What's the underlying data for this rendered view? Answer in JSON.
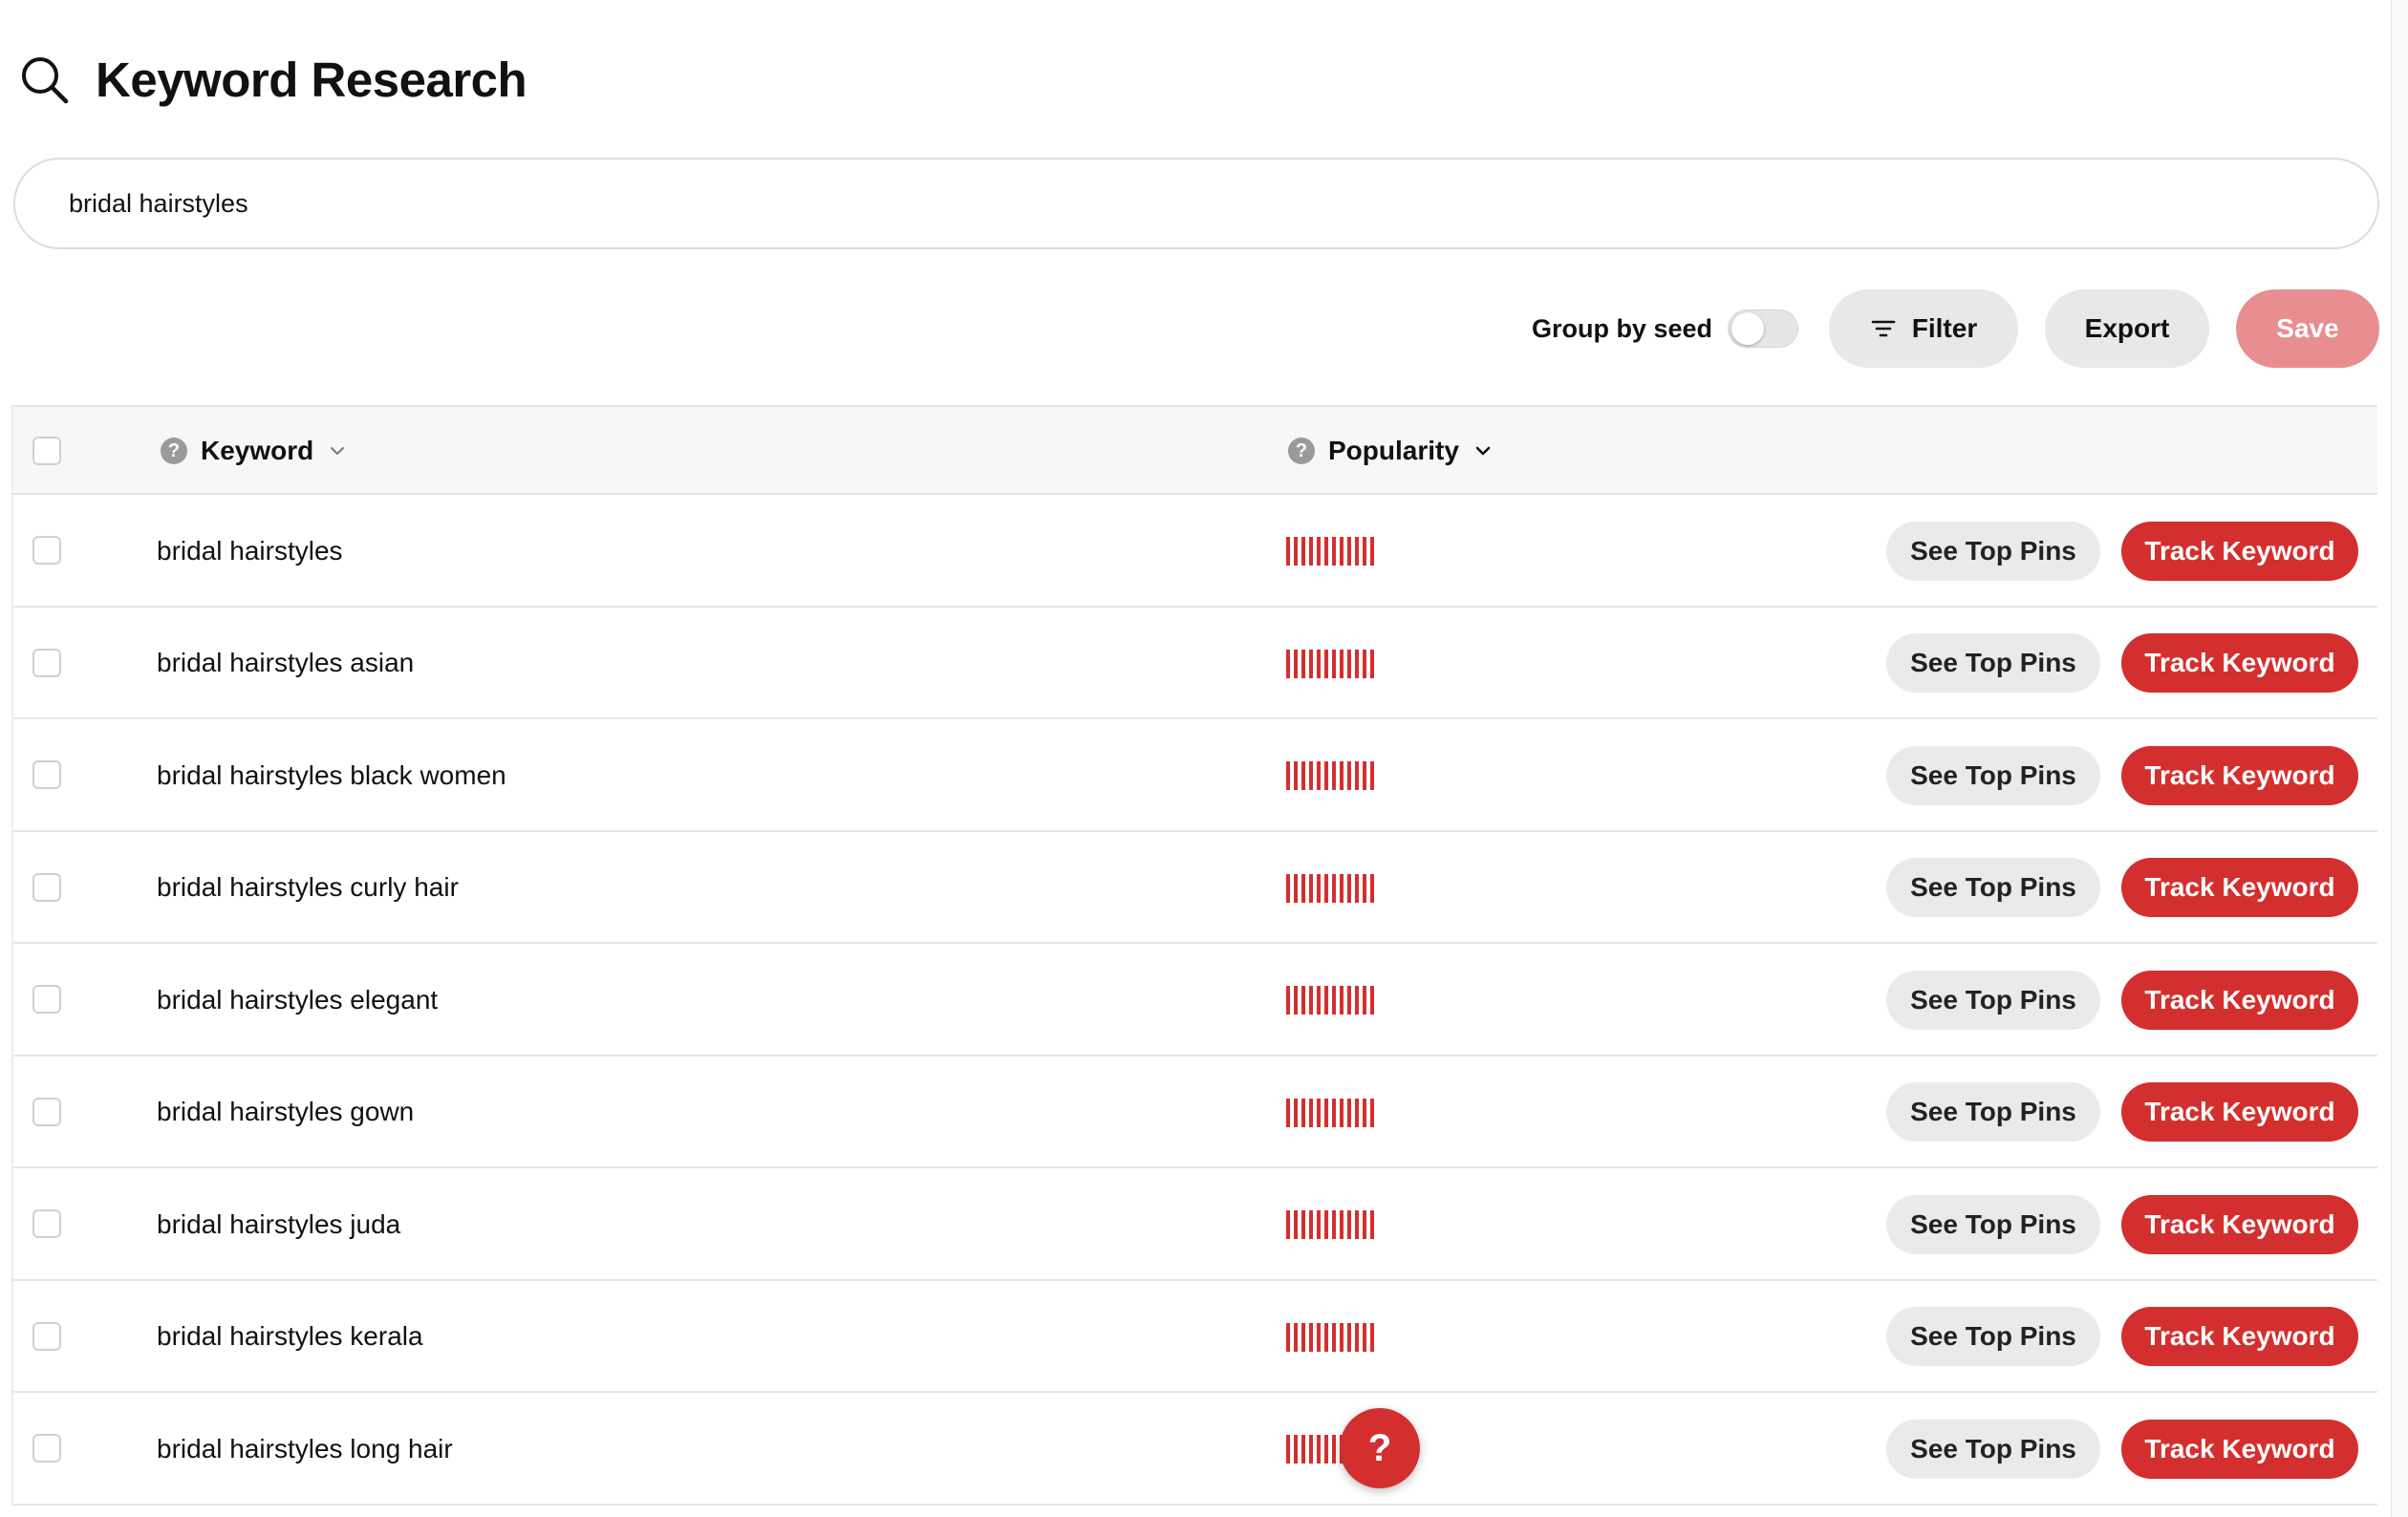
{
  "header": {
    "title": "Keyword Research",
    "icon": "search-icon"
  },
  "search": {
    "value": "bridal hairstyles"
  },
  "toolbar": {
    "group_by_seed_label": "Group by seed",
    "group_by_seed_enabled": false,
    "filter_label": "Filter",
    "export_label": "Export",
    "save_label": "Save"
  },
  "table": {
    "columns": {
      "keyword": "Keyword",
      "popularity": "Popularity"
    },
    "row_actions": {
      "see_top_pins": "See Top Pins",
      "track_keyword": "Track Keyword"
    },
    "rows": [
      {
        "keyword": "bridal hairstyles",
        "popularity_bars": 12
      },
      {
        "keyword": "bridal hairstyles asian",
        "popularity_bars": 12
      },
      {
        "keyword": "bridal hairstyles black women",
        "popularity_bars": 12
      },
      {
        "keyword": "bridal hairstyles curly hair",
        "popularity_bars": 12
      },
      {
        "keyword": "bridal hairstyles elegant",
        "popularity_bars": 12
      },
      {
        "keyword": "bridal hairstyles gown",
        "popularity_bars": 12
      },
      {
        "keyword": "bridal hairstyles juda",
        "popularity_bars": 12
      },
      {
        "keyword": "bridal hairstyles kerala",
        "popularity_bars": 12
      },
      {
        "keyword": "bridal hairstyles long hair",
        "popularity_bars": 12
      }
    ]
  },
  "help_fab": {
    "label": "?"
  },
  "colors": {
    "accent": "#d32f2f",
    "save_disabled": "#e88e90",
    "neutral_button": "#e8e8e8"
  }
}
